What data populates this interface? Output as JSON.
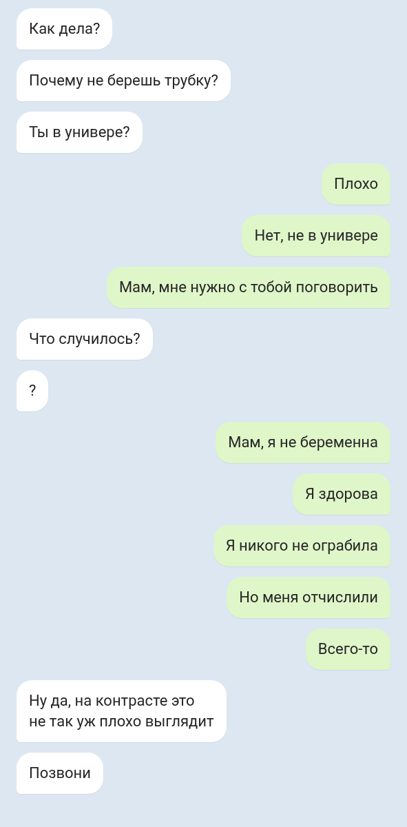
{
  "messages": [
    {
      "text": "Как дела?",
      "outgoing": false
    },
    {
      "text": "Почему не берешь трубку?",
      "outgoing": false
    },
    {
      "text": "Ты в универе?",
      "outgoing": false
    },
    {
      "text": "Плохо",
      "outgoing": true
    },
    {
      "text": "Нет, не в универе",
      "outgoing": true
    },
    {
      "text": "Мам, мне нужно с тобой поговорить",
      "outgoing": true
    },
    {
      "text": "Что случилось?",
      "outgoing": false
    },
    {
      "text": "?",
      "outgoing": false
    },
    {
      "text": "Мам, я не беременна",
      "outgoing": true
    },
    {
      "text": "Я здорова",
      "outgoing": true
    },
    {
      "text": "Я никого не ограбила",
      "outgoing": true
    },
    {
      "text": "Но меня отчислили",
      "outgoing": true
    },
    {
      "text": "Всего-то",
      "outgoing": true
    },
    {
      "text": "Ну да, на контрасте это\nне так уж плохо выглядит",
      "outgoing": false
    },
    {
      "text": "Позвони",
      "outgoing": false
    }
  ]
}
